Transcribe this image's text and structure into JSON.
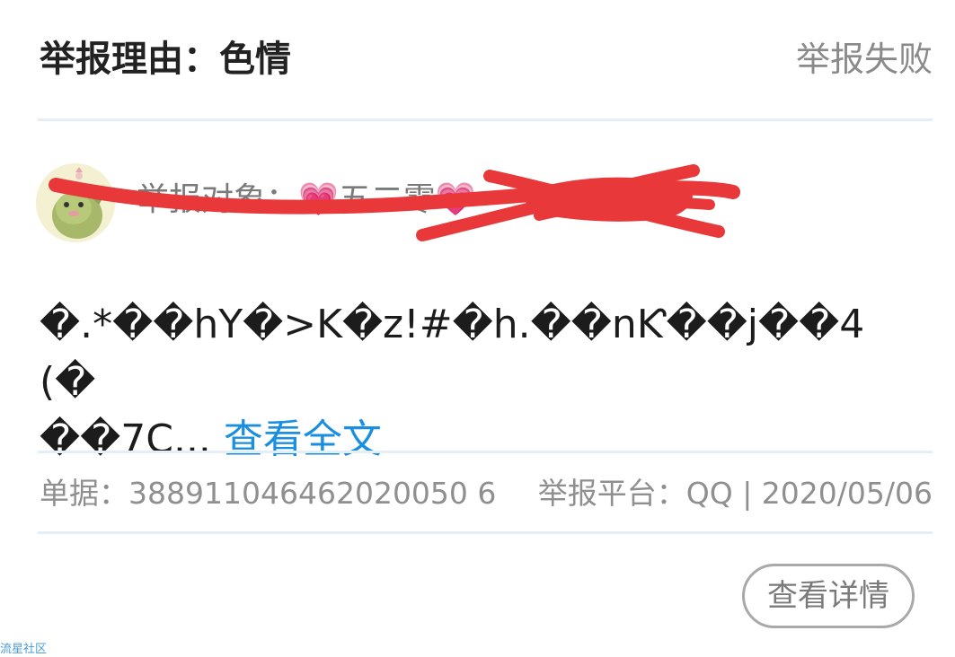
{
  "header": {
    "reason": "举报理由：色情",
    "status": "举报失败"
  },
  "target": {
    "label": "举报对象：",
    "heart_left": "💗",
    "name": "五二零",
    "heart_right": "💗",
    "avatar_icon": "dinosaur-avatar-icon"
  },
  "content": {
    "text_line1": "�.*��hY�>K�z!#�h.��nƘ��j��4(�",
    "text_line2": "��7C...",
    "more_label": "查看全文"
  },
  "meta": {
    "ticket_label": "单据：",
    "ticket_number": "388911046462020050 6",
    "platform_label": "举报平台：",
    "platform_value": "QQ | 2020/05/06"
  },
  "actions": {
    "detail_button": "查看详情"
  },
  "watermark": "流星社区",
  "colors": {
    "accent": "#1a8fe0",
    "redaction": "#e8383a"
  }
}
